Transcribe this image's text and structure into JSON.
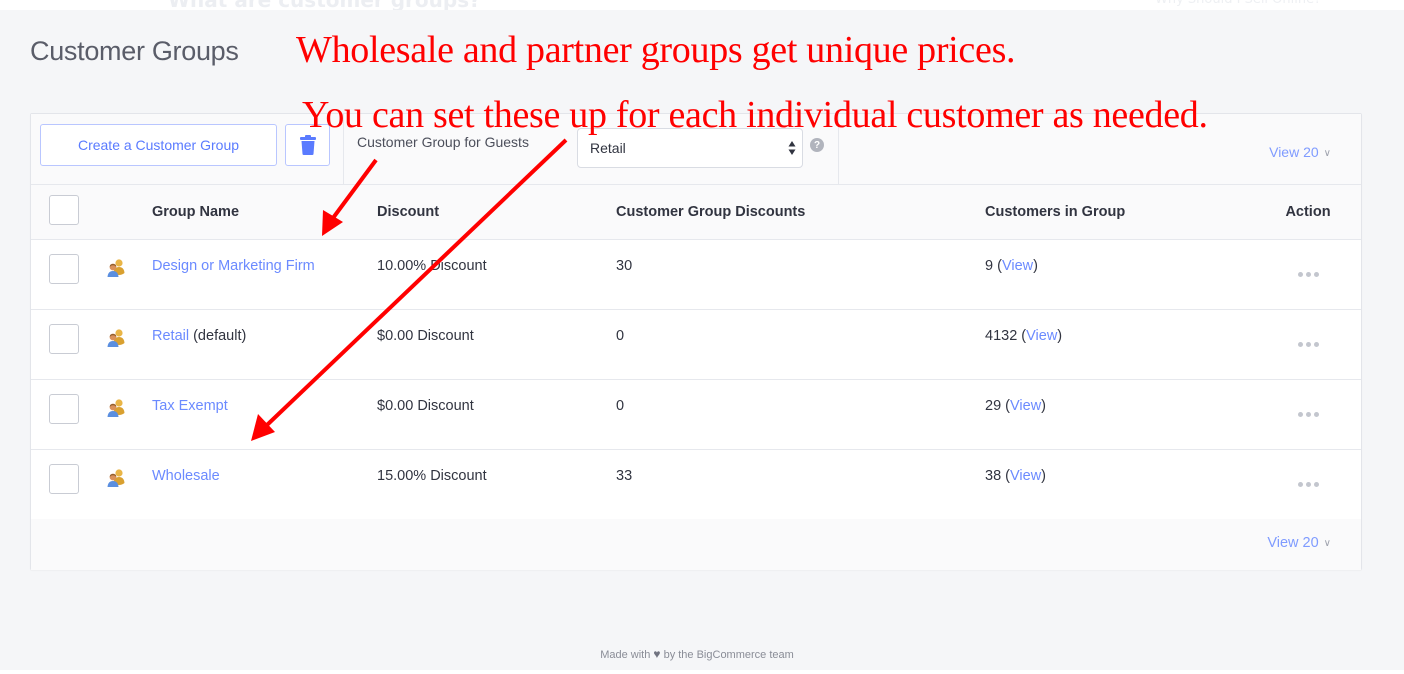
{
  "background_ghost": {
    "left_heading": "What are customer groups?",
    "right_link": "Why Should I Sell Online?"
  },
  "page": {
    "title": "Customer Groups"
  },
  "toolbar": {
    "create_label": "Create a Customer Group",
    "delete_icon": "trash-icon",
    "guest_label": "Customer Group for Guests",
    "guest_select_value": "Retail",
    "help_icon": "?",
    "view_label": "View 20",
    "view_chevron": "⌄"
  },
  "table": {
    "headers": {
      "select_all": "",
      "group_name": "Group Name",
      "discount": "Discount",
      "customer_group_discounts": "Customer Group Discounts",
      "customers_in_group": "Customers in Group",
      "action": "Action"
    },
    "rows": [
      {
        "name": "Design or Marketing Firm",
        "suffix": "",
        "discount": "10.00% Discount",
        "group_discounts": "30",
        "customers": "9",
        "view_link": "View"
      },
      {
        "name": "Retail",
        "suffix": " (default)",
        "discount": "$0.00 Discount",
        "group_discounts": "0",
        "customers": "4132",
        "view_link": "View"
      },
      {
        "name": "Tax Exempt",
        "suffix": "",
        "discount": "$0.00 Discount",
        "group_discounts": "0",
        "customers": "29",
        "view_link": "View"
      },
      {
        "name": "Wholesale",
        "suffix": "",
        "discount": "15.00% Discount",
        "group_discounts": "33",
        "customers": "38",
        "view_link": "View"
      }
    ]
  },
  "pagination": {
    "view_label": "View 20"
  },
  "footer": {
    "made_with": "Made with",
    "heart": "♥",
    "by_team": "by the BigCommerce team"
  },
  "annotations": {
    "line1": "Wholesale and partner groups get unique prices.",
    "line2": "You can set these up for each individual customer as needed.",
    "color": "#ff0000"
  },
  "colors": {
    "accent": "#6b8aff",
    "page_bg": "#f5f6f8",
    "text": "#313440"
  }
}
